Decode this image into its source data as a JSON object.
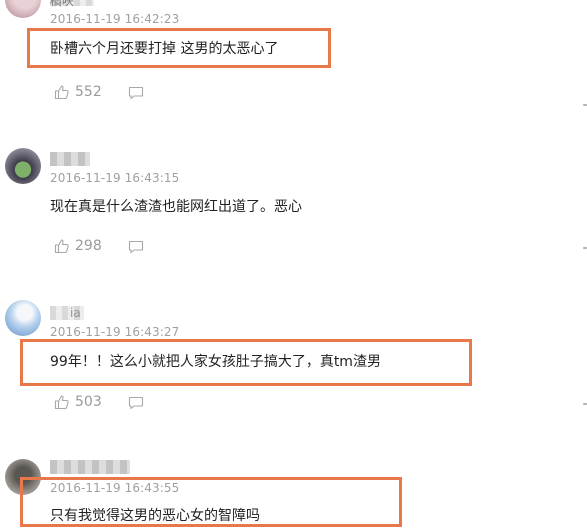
{
  "comments": [
    {
      "username": "橘呋",
      "timestamp": "2016-11-19 16:42:23",
      "text": "卧槽六个月还要打掉 这男的太恶心了",
      "likes": "552"
    },
    {
      "username": "",
      "timestamp": "2016-11-19 16:43:15",
      "text": "现在真是什么渣渣也能网红出道了。恶心",
      "likes": "298"
    },
    {
      "username": "ia",
      "timestamp": "2016-11-19 16:43:27",
      "text": "99年！！这么小就把人家女孩肚子搞大了，真tm渣男",
      "likes": "503"
    },
    {
      "username": "",
      "timestamp": "2016-11-19 16:43:55",
      "text": "只有我觉得这男的恶心女的智障吗",
      "likes": ""
    }
  ],
  "colors": {
    "highlight": "#e8774a",
    "timestamp": "#a0a0a0",
    "muted": "#9a9a9a"
  },
  "icons": {
    "like": "thumbs-up-icon",
    "reply": "comment-bubble-icon"
  }
}
